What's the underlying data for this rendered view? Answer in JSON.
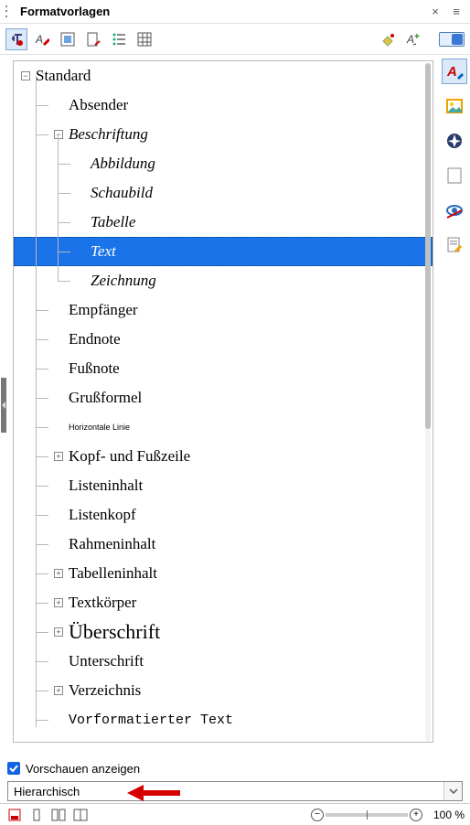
{
  "panel": {
    "title": "Formatvorlagen"
  },
  "toolbar": {
    "buttons": [
      {
        "name": "paragraph-styles-icon",
        "active": true
      },
      {
        "name": "character-styles-icon",
        "active": false
      },
      {
        "name": "frame-styles-icon",
        "active": false
      },
      {
        "name": "page-styles-icon",
        "active": false
      },
      {
        "name": "list-styles-icon",
        "active": false
      },
      {
        "name": "table-styles-icon",
        "active": false
      }
    ],
    "right_buttons": [
      {
        "name": "fill-format-icon"
      },
      {
        "name": "new-style-icon"
      }
    ]
  },
  "tree": {
    "items": [
      {
        "label": "Standard",
        "indent": 0,
        "twisty": "-",
        "style": ""
      },
      {
        "label": "Absender",
        "indent": 1,
        "twisty": null,
        "style": ""
      },
      {
        "label": "Beschriftung",
        "indent": 1,
        "twisty": "-",
        "style": "italic"
      },
      {
        "label": "Abbildung",
        "indent": 2,
        "twisty": null,
        "style": "italic"
      },
      {
        "label": "Schaubild",
        "indent": 2,
        "twisty": null,
        "style": "italic"
      },
      {
        "label": "Tabelle",
        "indent": 2,
        "twisty": null,
        "style": "italic"
      },
      {
        "label": "Text",
        "indent": 2,
        "twisty": null,
        "style": "italic",
        "selected": true
      },
      {
        "label": "Zeichnung",
        "indent": 2,
        "twisty": null,
        "style": "italic"
      },
      {
        "label": "Empfänger",
        "indent": 1,
        "twisty": null,
        "style": ""
      },
      {
        "label": "Endnote",
        "indent": 1,
        "twisty": null,
        "style": ""
      },
      {
        "label": "Fußnote",
        "indent": 1,
        "twisty": null,
        "style": ""
      },
      {
        "label": "Grußformel",
        "indent": 1,
        "twisty": null,
        "style": ""
      },
      {
        "label": "Horizontale Linie",
        "indent": 1,
        "twisty": null,
        "style": "small"
      },
      {
        "label": "Kopf- und Fußzeile",
        "indent": 1,
        "twisty": "+",
        "style": ""
      },
      {
        "label": "Listeninhalt",
        "indent": 1,
        "twisty": null,
        "style": ""
      },
      {
        "label": "Listenkopf",
        "indent": 1,
        "twisty": null,
        "style": ""
      },
      {
        "label": "Rahmeninhalt",
        "indent": 1,
        "twisty": null,
        "style": ""
      },
      {
        "label": "Tabelleninhalt",
        "indent": 1,
        "twisty": "+",
        "style": ""
      },
      {
        "label": "Textkörper",
        "indent": 1,
        "twisty": "+",
        "style": ""
      },
      {
        "label": "Überschrift",
        "indent": 1,
        "twisty": "+",
        "style": "heading"
      },
      {
        "label": "Unterschrift",
        "indent": 1,
        "twisty": null,
        "style": ""
      },
      {
        "label": "Verzeichnis",
        "indent": 1,
        "twisty": "+",
        "style": ""
      },
      {
        "label": "Vorformatierter Text",
        "indent": 1,
        "twisty": null,
        "style": "preformatted"
      }
    ]
  },
  "sidebar": {
    "items": [
      {
        "name": "styles-tab-icon",
        "selected": true,
        "color": "#d91c1c"
      },
      {
        "name": "gallery-tab-icon",
        "selected": false
      },
      {
        "name": "navigator-tab-icon",
        "selected": false
      },
      {
        "name": "page-tab-icon",
        "selected": false
      },
      {
        "name": "inspector-tab-icon",
        "selected": false
      },
      {
        "name": "manage-changes-tab-icon",
        "selected": false
      }
    ]
  },
  "bottom": {
    "checkbox_label": "Vorschauen anzeigen",
    "checkbox_checked": true,
    "combo_value": "Hierarchisch"
  },
  "status": {
    "zoom": "100 %"
  }
}
